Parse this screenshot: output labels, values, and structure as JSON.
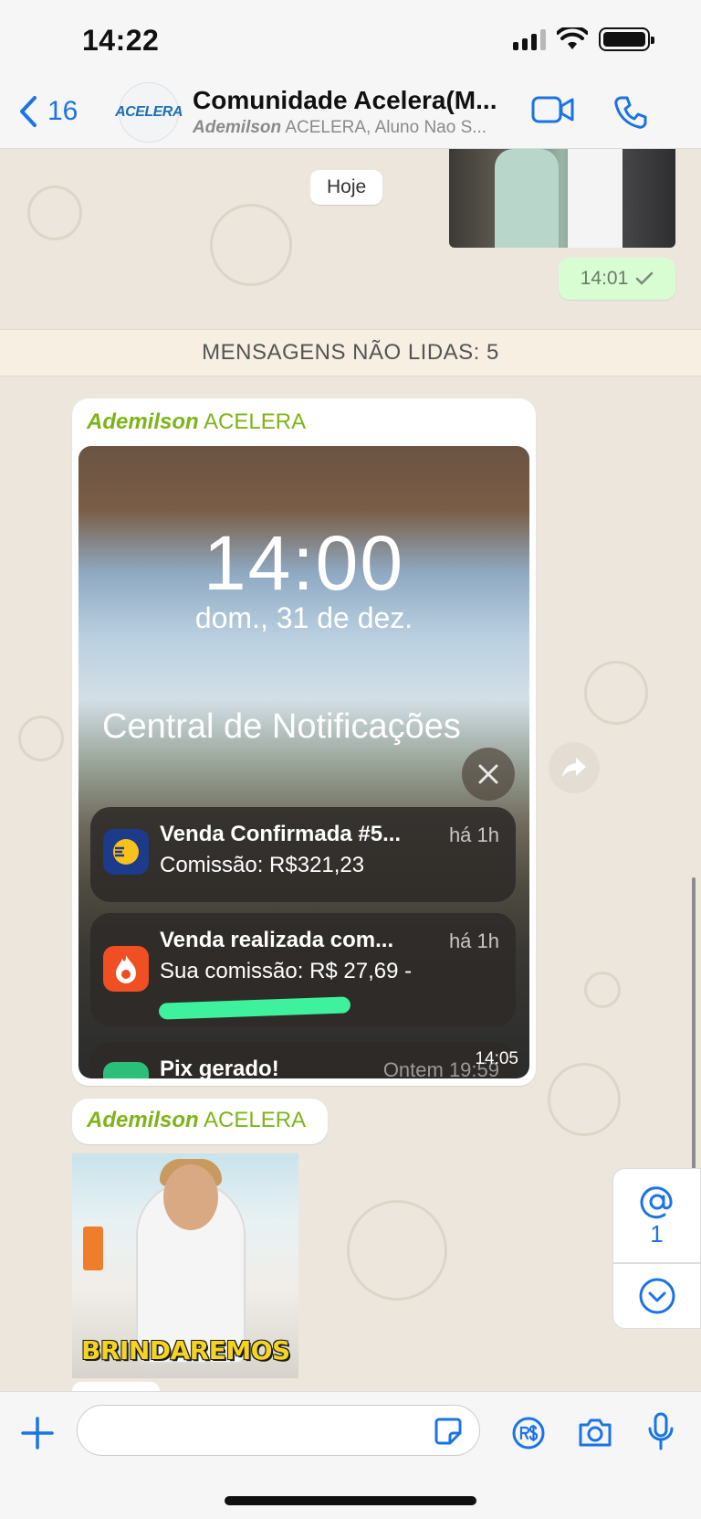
{
  "status_bar": {
    "time": "14:22"
  },
  "header": {
    "back_count": "16",
    "avatar_text": "ACELERA",
    "title": "Comunidade Acelera(M...",
    "subtitle_bold": "Ademilson",
    "subtitle_rest": " ACELERA, Aluno Nao S..."
  },
  "chat": {
    "date_chip": "Hoje",
    "sent_time": "14:01",
    "unread_banner": "MENSAGENS NÃO LIDAS: 5",
    "message1": {
      "sender_first": "Ademilson",
      "sender_rest": " ACELERA",
      "time": "14:05",
      "screenshot": {
        "lock_time": "14:00",
        "lock_date": "dom., 31 de dez.",
        "notification_center": "Central de Notificações",
        "notifications": [
          {
            "title": "Venda Confirmada #5...",
            "ago": "há 1h",
            "detail": "Comissão: R$321,23"
          },
          {
            "title": "Venda realizada com...",
            "ago": "há 1h",
            "detail": "Sua comissão: R$ 27,69 -"
          },
          {
            "title": "Pix gerado!",
            "ago": "Ontem 19:59"
          }
        ]
      }
    },
    "message2": {
      "sender_first": "Ademilson",
      "sender_rest": " ACELERA",
      "sticker_text": "BRINDAREMOS"
    },
    "mention_count": "1"
  },
  "input_bar": {
    "placeholder": ""
  },
  "colors": {
    "accent": "#1a73e8",
    "sender": "#7cb518",
    "sent_bubble": "#d9fdd3"
  }
}
